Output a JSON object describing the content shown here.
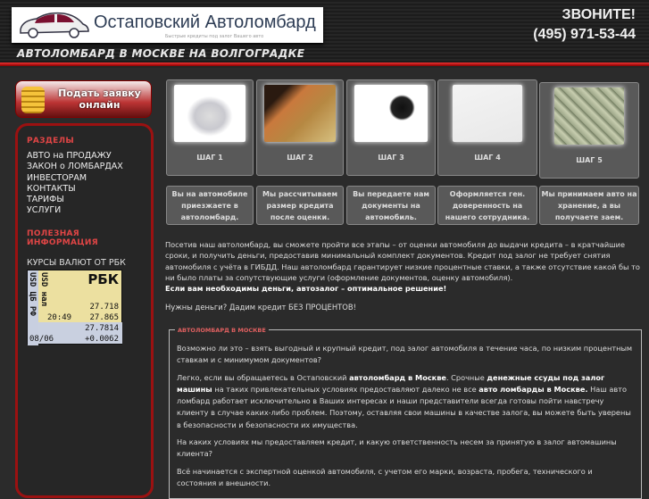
{
  "header": {
    "logo_title": "Остаповский Автоломбард",
    "logo_subtitle": "Быстрые кредиты под залог Вашего авто",
    "tagline": "АВТОЛОМБАРД В МОСКВЕ НА ВОЛГОГРАДКЕ",
    "call": "ЗВОНИТЕ!",
    "phone": "(495) 971-53-44"
  },
  "apply_button": {
    "line1": "Подать заявку",
    "line2": "онлайн"
  },
  "sidebar": {
    "sections_title": "РАЗДЕЛЫ",
    "items": [
      {
        "label": "АВТО на ПРОДАЖУ"
      },
      {
        "label": "ЗАКОН о ЛОМБАРДАХ"
      },
      {
        "label": "ИНВЕСТОРАМ"
      },
      {
        "label": "КОНТАКТЫ"
      },
      {
        "label": "ТАРИФЫ"
      },
      {
        "label": "УСЛУГИ"
      }
    ],
    "info_title": "ПОЛЕЗНАЯ ИНФОРМАЦИЯ",
    "rates_label": "КУРСЫ ВАЛЮТ ОТ РБК",
    "rbk": {
      "brand": "РБК",
      "left_label": "USD ЦБ РФ",
      "mid_label": "USD нал",
      "v1": "27.718",
      "time": "20:49",
      "v2": "27.865",
      "v3": "27.7814",
      "date": "08/06",
      "delta": "+0.0062"
    }
  },
  "steps": [
    {
      "label": "ШАГ 1",
      "desc": "Вы на автомобиле приезжаете в автоломбард.",
      "image": "car"
    },
    {
      "label": "ШАГ 2",
      "desc": "Мы рассчитываем размер кредита после оценки.",
      "image": "calculator"
    },
    {
      "label": "ШАГ 3",
      "desc": "Вы передаете нам документы на автомобиль.",
      "image": "keys"
    },
    {
      "label": "ШАГ 4",
      "desc": "Оформляется ген. доверенность на нашего сотрудника.",
      "image": "signature"
    },
    {
      "label": "ШАГ 5",
      "desc": "Мы принимаем авто на хранение, а вы получаете заем.",
      "image": "money"
    }
  ],
  "intro": {
    "text": "Посетив наш автоломбард, вы сможете пройти все этапы – от оценки автомобиля до выдачи кредита – в кратчайшие сроки, и получить деньги, предоставив минимальный комплект документов. Кредит под залог не требует снятия автомобиля с учёта в ГИБДД. Наш автоломбард гарантирует низкие процентные ставки, а также отсутствие какой бы то ни было платы за сопутствующие услуги (оформление документов, оценку автомобиля).",
    "bold": "Если вам необходимы деньги, автозалог – оптимальное решение!",
    "need": "Нужны деньги? Дадим кредит БЕЗ ПРОЦЕНТОВ!"
  },
  "moscow_box": {
    "legend": "АВТОЛОМБАРД В МОСКВЕ",
    "p1": "Возможно ли это – взять выгодный и крупный кредит, под залог автомобиля в течение часа, по низким процентным ставкам и с минимумом документов?",
    "p2_a": "Легко, если вы обращаетесь в Остаповский ",
    "p2_b1": "автоломбард в Москве",
    "p2_c": ". Срочные ",
    "p2_b2": "денежные ссуды под залог машины",
    "p2_d": " на таких привлекательных условиях предоставляют далеко не все ",
    "p2_b3": "авто ломбарды в Москве.",
    "p2_e": " Наш авто ломбард работает исключительно в Ваших интересах и наши представители всегда готовы пойти навстречу клиенту в случае каких-либо проблем. Поэтому, оставляя свои машины в качестве залога, вы можете быть уверены в безопасности и безопасности их имущества.",
    "p3": "На каких условиях мы предоставляем кредит, и какую ответственность несем за принятую в залог автомашины клиента?",
    "p4": "Всё начинается с экспертной оценкой автомобиля, с учетом его марки, возраста, пробега, технического и состояния и внешности."
  }
}
